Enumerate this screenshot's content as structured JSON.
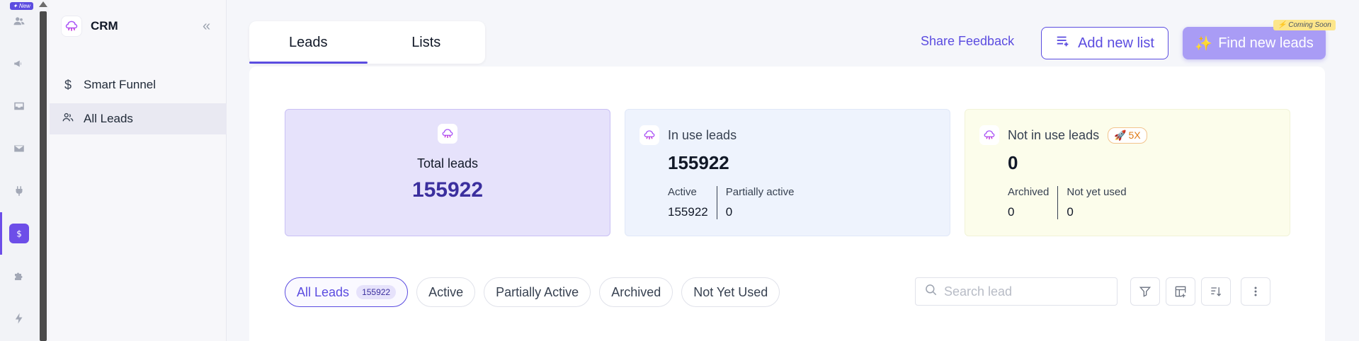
{
  "rail": {
    "new_badge": "✦ New",
    "icons": [
      "users-icon",
      "megaphone-icon",
      "inbox-icon",
      "mail-icon",
      "plug-icon",
      "dollar-icon",
      "puzzle-icon",
      "lightning-icon"
    ]
  },
  "sidebar": {
    "title": "CRM",
    "items": [
      {
        "label": "Smart Funnel",
        "icon": "dollar-icon"
      },
      {
        "label": "All Leads",
        "icon": "users-icon"
      }
    ]
  },
  "tabs": [
    {
      "label": "Leads",
      "active": true
    },
    {
      "label": "Lists",
      "active": false
    }
  ],
  "header": {
    "share_feedback": "Share Feedback",
    "add_list": "Add new list",
    "find_leads": "Find new leads",
    "coming_soon": "⚡ Coming Soon"
  },
  "cards": {
    "total": {
      "label": "Total leads",
      "value": "155922"
    },
    "in_use": {
      "title": "In use leads",
      "value": "155922",
      "stats": [
        {
          "label": "Active",
          "value": "155922"
        },
        {
          "label": "Partially active",
          "value": "0"
        }
      ]
    },
    "not_in_use": {
      "title": "Not in use leads",
      "badge": "5X",
      "value": "0",
      "stats": [
        {
          "label": "Archived",
          "value": "0"
        },
        {
          "label": "Not yet used",
          "value": "0"
        }
      ]
    }
  },
  "filters": [
    {
      "label": "All Leads",
      "count": "155922",
      "active": true
    },
    {
      "label": "Active"
    },
    {
      "label": "Partially Active"
    },
    {
      "label": "Archived"
    },
    {
      "label": "Not Yet Used"
    }
  ],
  "search": {
    "placeholder": "Search lead",
    "value": ""
  },
  "colors": {
    "accent": "#5b4ce0",
    "accent_light": "#a99cf5",
    "total_card": "#e6e2fb",
    "inuse_card": "#eef3fd",
    "notinuse_card": "#fcfdeb"
  }
}
